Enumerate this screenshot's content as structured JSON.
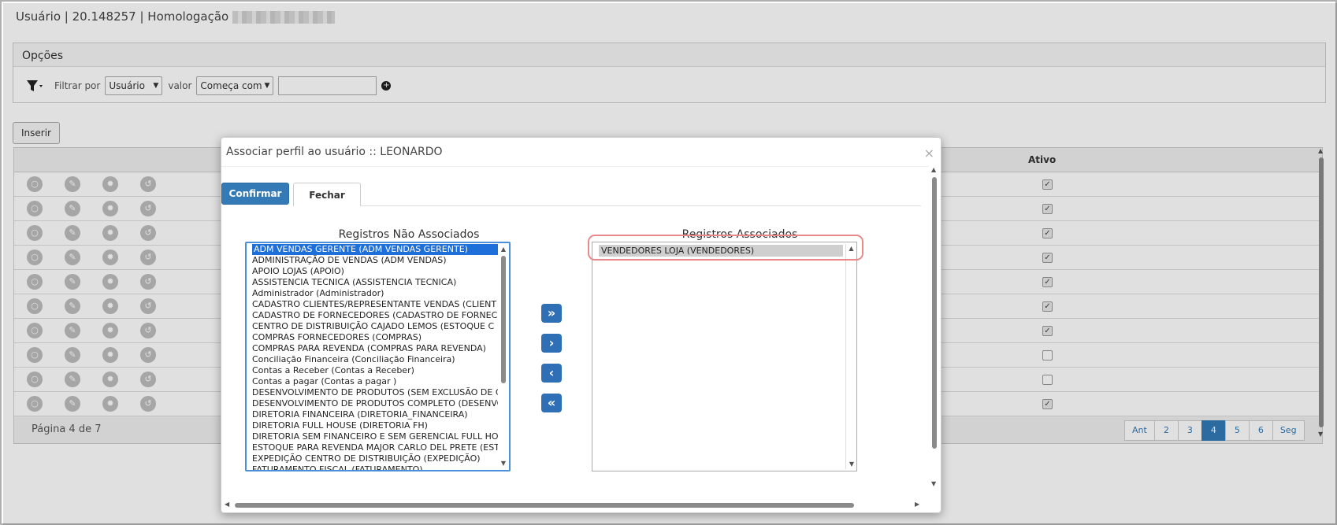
{
  "page": {
    "title_prefix": "Usuário | 20.148257 | Homologação"
  },
  "options_panel": {
    "heading": "Opções",
    "filter_label": "Filtrar por",
    "filter_field_selected": "Usuário",
    "value_label": "valor",
    "operator_selected": "Começa com",
    "value_input": ""
  },
  "toolbar": {
    "insert_label": "Inserir"
  },
  "table": {
    "col_active": "Ativo",
    "rows_active": [
      true,
      true,
      true,
      true,
      true,
      true,
      true,
      false,
      false,
      true
    ],
    "page_label": "Página 4 de 7",
    "pager": [
      "Ant",
      "2",
      "3",
      "4",
      "5",
      "6",
      "Seg"
    ],
    "current_page": "4"
  },
  "modal": {
    "title": "Associar perfil ao usuário :: LEONARDO",
    "close_glyph": "×",
    "confirm_label": "Confirmar",
    "close_label": "Fechar",
    "unassociated_label": "Registros Não Associados",
    "associated_label": "Registros Associados",
    "unassociated_items": [
      "ADM VENDAS GERENTE (ADM VENDAS GERENTE)",
      "ADMINISTRAÇÃO DE VENDAS (ADM VENDAS)",
      "APOIO LOJAS (APOIO)",
      "ASSISTENCIA TECNICA (ASSISTENCIA TECNICA)",
      "Administrador (Administrador)",
      "CADASTRO CLIENTES/REPRESENTANTE VENDAS (CLIENT",
      "CADASTRO DE FORNECEDORES (CADASTRO DE FORNECE",
      "CENTRO DE DISTRIBUIÇÃO CAJADO LEMOS (ESTOQUE C",
      "COMPRAS FORNECEDORES (COMPRAS)",
      "COMPRAS PARA REVENDA (COMPRAS PARA REVENDA)",
      "Conciliação Financeira (Conciliação Financeira)",
      "Contas a Receber (Contas a Receber)",
      "Contas a pagar (Contas a pagar )",
      "DESENVOLVIMENTO DE PRODUTOS (SEM EXCLUSÃO DE C",
      "DESENVOLVIMENTO DE PRODUTOS COMPLETO (DESENVO",
      "DIRETORIA FINANCEIRA (DIRETORIA_FINANCEIRA)",
      "DIRETORIA FULL HOUSE (DIRETORIA FH)",
      "DIRETORIA SEM FINANCEIRO E SEM GERENCIAL FULL HO",
      "ESTOQUE PARA REVENDA MAJOR CARLO DEL PRETE (EST",
      "EXPEDIÇÃO CENTRO DE DISTRIBUIÇÃO (EXPEDIÇÃO)",
      "FATURAMENTO FISCAL (FATURAMENTO)"
    ],
    "associated_items": [
      "VENDEDORES LOJA (VENDEDORES)"
    ],
    "arrows": [
      "»",
      "›",
      "‹",
      "«"
    ]
  },
  "colors": {
    "primary": "#337ab7",
    "highlight_ring": "#e88a8a",
    "selection": "#1e6fd9"
  }
}
